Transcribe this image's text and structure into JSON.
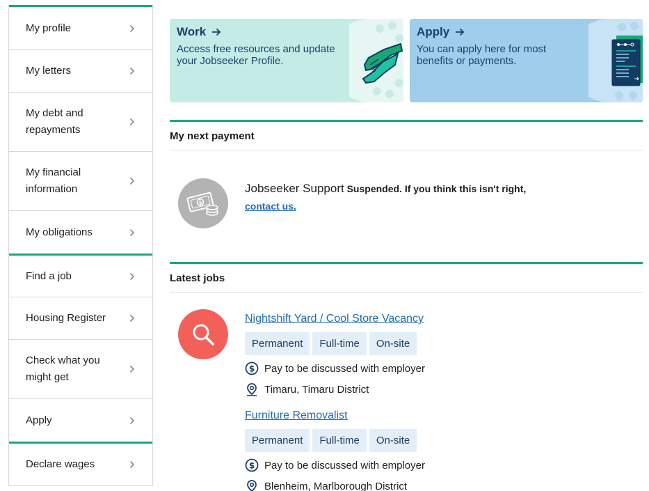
{
  "sidebar": {
    "groups": [
      [
        {
          "label": "My profile"
        },
        {
          "label": "My letters"
        },
        {
          "label": "My debt and repayments"
        },
        {
          "label": "My financial information"
        },
        {
          "label": "My obligations"
        }
      ],
      [
        {
          "label": "Find a job"
        },
        {
          "label": "Housing Register"
        },
        {
          "label": "Check what you might get"
        },
        {
          "label": "Apply"
        }
      ],
      [
        {
          "label": "Declare wages"
        }
      ]
    ]
  },
  "cards": {
    "work": {
      "title": "Work",
      "description": "Access free resources and update your Jobseeker Profile."
    },
    "apply": {
      "title": "Apply",
      "description": "You can apply here for most benefits or payments."
    }
  },
  "next_payment": {
    "heading": "My next payment",
    "benefit": "Jobseeker Support",
    "message": "Suspended. If you think this isn't right,",
    "link": "contact us."
  },
  "latest_jobs": {
    "heading": "Latest jobs",
    "jobs": [
      {
        "title": "Nightshift Yard / Cool Store Vacancy",
        "tags": [
          "Permanent",
          "Full-time",
          "On-site"
        ],
        "pay": "Pay to be discussed with employer",
        "location": "Timaru, Timaru District"
      },
      {
        "title": "Furniture Removalist",
        "tags": [
          "Permanent",
          "Full-time",
          "On-site"
        ],
        "pay": "Pay to be discussed with employer",
        "location": "Blenheim, Marlborough District"
      }
    ]
  },
  "colors": {
    "accent": "#17a974",
    "link": "#1f6cb5",
    "work_card": "#c3ece6",
    "apply_card": "#9fcdec",
    "search_circle": "#f3605a"
  }
}
